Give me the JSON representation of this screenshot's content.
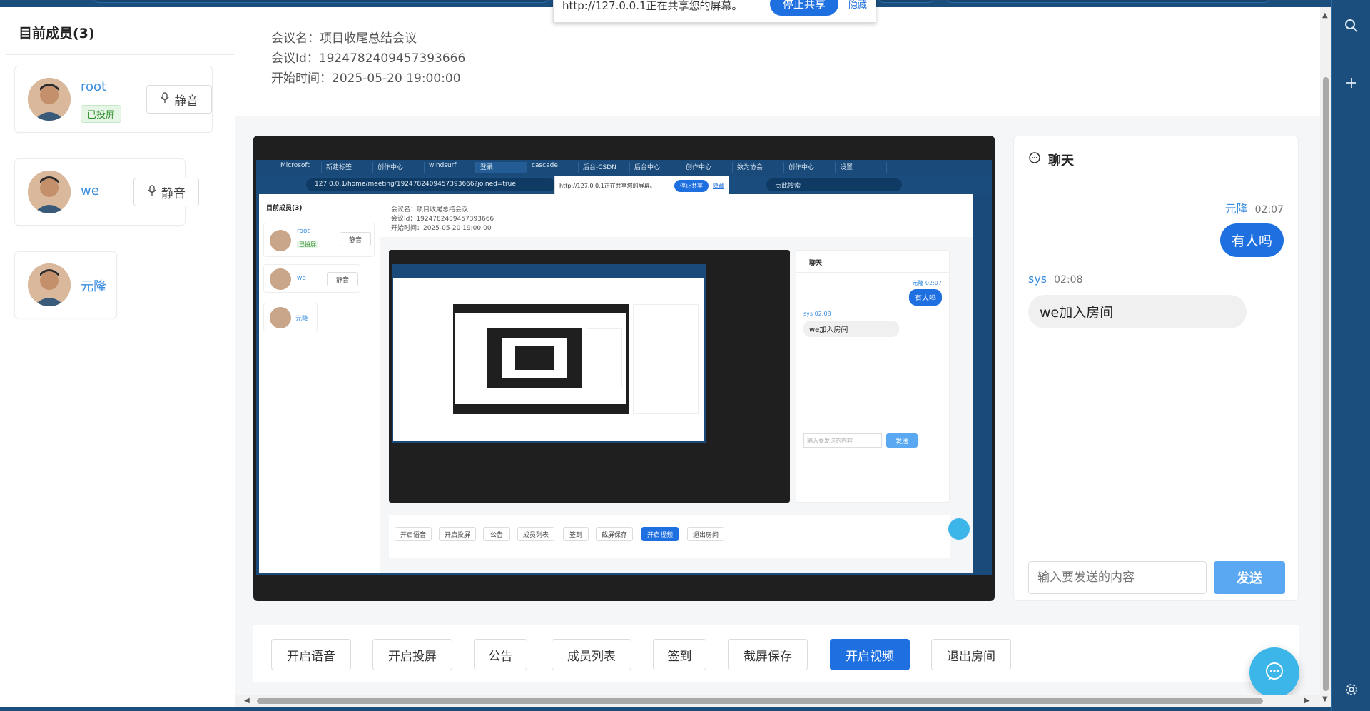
{
  "share_bar": {
    "text": "http://127.0.0.1正在共享您的屏幕。",
    "stop_label": "停止共享",
    "hide_label": "隐藏"
  },
  "sidebar": {
    "title": "目前成员(3)",
    "members": [
      {
        "name": "root",
        "badge": "已投屏",
        "mute_label": "静音"
      },
      {
        "name": "we",
        "mute_label": "静音"
      },
      {
        "name": "元隆"
      }
    ]
  },
  "meeting": {
    "name_line": "会议名：项目收尾总结会议",
    "id_line": "会议Id：1924782409457393666",
    "start_line": "开始时间：2025-05-20 19:00:00"
  },
  "chat": {
    "title": "聊天",
    "messages": [
      {
        "sender": "元隆",
        "time": "02:07",
        "text": "有人吗",
        "side": "right"
      },
      {
        "sender": "sys",
        "time": "02:08",
        "text": "we加入房间",
        "side": "left"
      }
    ],
    "input_placeholder": "输入要发送的内容",
    "send_label": "发送"
  },
  "actions": [
    {
      "label": "开启语音"
    },
    {
      "label": "开启投屏"
    },
    {
      "label": "公告"
    },
    {
      "label": "成员列表"
    },
    {
      "label": "签到"
    },
    {
      "label": "截屏保存"
    },
    {
      "label": "开启视频",
      "primary": true
    },
    {
      "label": "退出房间"
    }
  ],
  "nested": {
    "tabs": [
      "Microsoft",
      "新建标签",
      "创作中心",
      "windsurf",
      "登录",
      "cascade",
      "后台-CSDN",
      "后台中心",
      "创作中心",
      "数为协会",
      "创作中心",
      "设置"
    ],
    "url": "127.0.0.1/home/meeting/1924782409457393666?joined=true",
    "search": "点此搜索",
    "share_text": "http://127.0.0.1正在共享您的屏幕。",
    "stop_label": "停止共享",
    "hide_label": "隐藏",
    "sidebar_title": "目前成员(3)",
    "members": [
      {
        "name": "root",
        "badge": "已投屏",
        "mute_label": "静音"
      },
      {
        "name": "we",
        "mute_label": "静音"
      },
      {
        "name": "元隆"
      }
    ],
    "name_line": "会议名：项目收尾总结会议",
    "id_line": "会议Id：1924782409457393666",
    "start_line": "开始时间：2025-05-20 19:00:00",
    "chat_title": "聊天",
    "msg1_meta": "元隆 02:07",
    "msg1": "有人吗",
    "msg2_meta": "sys 02:08",
    "msg2": "we加入房间",
    "input_placeholder": "输入要发送的内容",
    "send_label": "发送",
    "actions": [
      "开启语音",
      "开启投屏",
      "公告",
      "成员列表",
      "签到",
      "截屏保存",
      "开启视频",
      "退出房间"
    ]
  },
  "colors": {
    "primary": "#1e6fe0",
    "link": "#3b8ee0",
    "browser_frame": "#1b4e7c",
    "fab": "#3cb6e8"
  }
}
